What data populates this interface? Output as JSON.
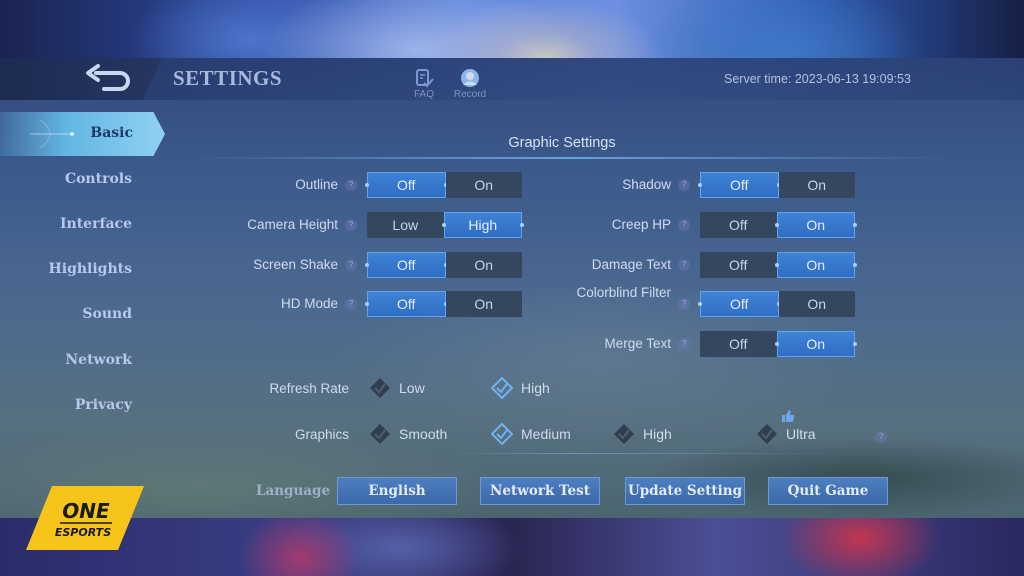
{
  "header": {
    "title": "SETTINGS",
    "faq_label": "FAQ",
    "record_label": "Record",
    "server_time": "Server time: 2023-06-13 19:09:53"
  },
  "sidebar": {
    "active": "Basic",
    "items": [
      {
        "label": "Basic"
      },
      {
        "label": "Controls"
      },
      {
        "label": "Interface"
      },
      {
        "label": "Highlights"
      },
      {
        "label": "Sound"
      },
      {
        "label": "Network"
      },
      {
        "label": "Privacy"
      }
    ]
  },
  "graphic_settings": {
    "title": "Graphic Settings",
    "left_toggles": [
      {
        "label": "Outline",
        "options": [
          "Off",
          "On"
        ],
        "selected": "Off"
      },
      {
        "label": "Camera Height",
        "options": [
          "Low",
          "High"
        ],
        "selected": "High"
      },
      {
        "label": "Screen Shake",
        "options": [
          "Off",
          "On"
        ],
        "selected": "Off"
      },
      {
        "label": "HD Mode",
        "options": [
          "Off",
          "On"
        ],
        "selected": "Off"
      }
    ],
    "right_toggles": [
      {
        "label": "Shadow",
        "options": [
          "Off",
          "On"
        ],
        "selected": "Off"
      },
      {
        "label": "Creep HP",
        "options": [
          "Off",
          "On"
        ],
        "selected": "On"
      },
      {
        "label": "Damage Text",
        "options": [
          "Off",
          "On"
        ],
        "selected": "On"
      },
      {
        "label": "Colorblind Filter",
        "options": [
          "Off",
          "On"
        ],
        "selected": "Off"
      },
      {
        "label": "Merge Text",
        "options": [
          "Off",
          "On"
        ],
        "selected": "On"
      }
    ],
    "refresh_rate": {
      "label": "Refresh Rate",
      "options": [
        "Low",
        "High"
      ],
      "selected": "High"
    },
    "graphics": {
      "label": "Graphics",
      "options": [
        "Smooth",
        "Medium",
        "High",
        "Ultra"
      ],
      "selected": "Medium",
      "recommended": "Ultra"
    },
    "help_glyph": "?"
  },
  "footer": {
    "language_label": "Language",
    "language_value": "English",
    "network_test": "Network Test",
    "update_setting": "Update Setting",
    "quit_game": "Quit Game"
  },
  "watermark": {
    "line1": "ONE",
    "line2": "ESPORTS",
    "color": "#f7c51a"
  },
  "colors": {
    "selected_toggle": "#3f82d6",
    "unselected_toggle": "#34475f",
    "text": "#d0dbee"
  }
}
